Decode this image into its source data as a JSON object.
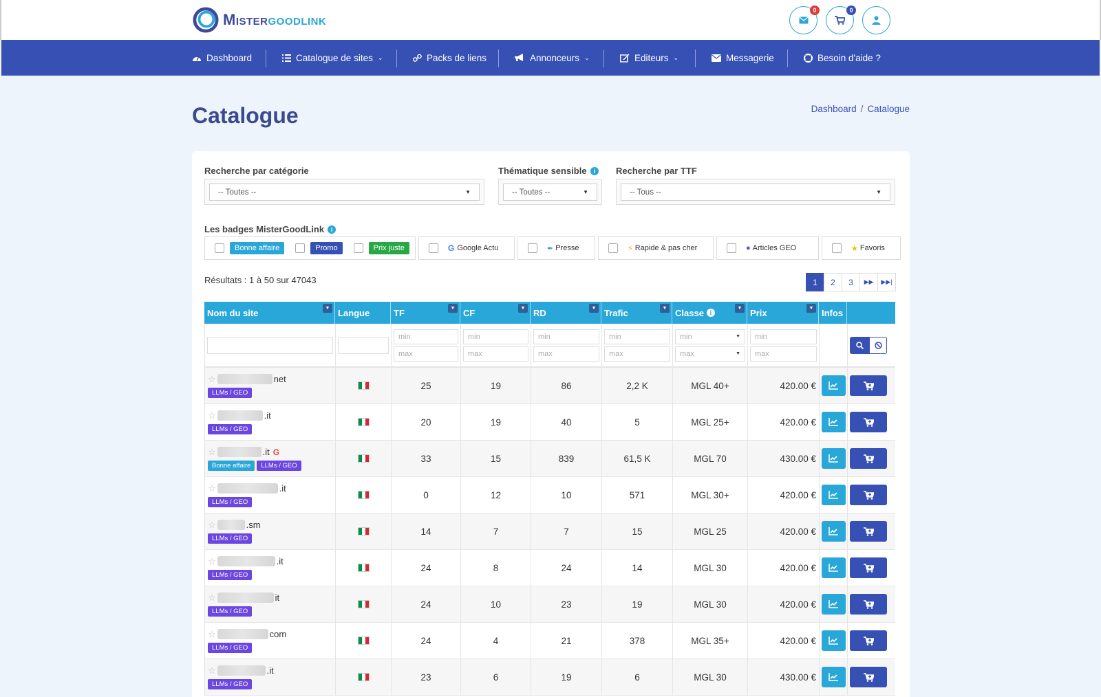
{
  "brand": {
    "name_part1": "Mister",
    "name_part2": "goodlink"
  },
  "header": {
    "messages_count": "0",
    "cart_count": "0"
  },
  "nav": [
    {
      "label": "Dashboard",
      "icon": "dashboard-icon"
    },
    {
      "label": "Catalogue de sites",
      "icon": "list-icon",
      "dropdown": true
    },
    {
      "label": "Packs de liens",
      "icon": "link-icon"
    },
    {
      "label": "Annonceurs",
      "icon": "megaphone-icon",
      "dropdown": true
    },
    {
      "label": "Editeurs",
      "icon": "edit-icon",
      "dropdown": true
    },
    {
      "label": "Messagerie",
      "icon": "envelope-icon"
    },
    {
      "label": "Besoin d'aide ?",
      "icon": "lifering-icon"
    }
  ],
  "page": {
    "title": "Catalogue",
    "breadcrumb": [
      "Dashboard",
      "Catalogue"
    ]
  },
  "filters": {
    "category": {
      "label": "Recherche par catégorie",
      "value": "-- Toutes --"
    },
    "sensitive": {
      "label": "Thématique sensible",
      "value": "-- Toutes --"
    },
    "ttf": {
      "label": "Recherche par TTF",
      "value": "-- Tous --"
    },
    "badges_label": "Les badges MisterGoodLink",
    "badges": {
      "bonne_affaire": "Bonne affaire",
      "promo": "Promo",
      "prix_juste": "Prix juste",
      "google_actu": "Google Actu",
      "presse": "Presse",
      "rapide": "Rapide & pas cher",
      "articles_geo": "Articles GEO",
      "favoris": "Favoris"
    }
  },
  "results": {
    "text": "Résultats : 1 à 50 sur 47043"
  },
  "pagination": {
    "pages": [
      "1",
      "2",
      "3"
    ],
    "active": "1"
  },
  "table": {
    "headers": {
      "site": "Nom du site",
      "langue": "Langue",
      "tf": "TF",
      "cf": "CF",
      "rd": "RD",
      "trafic": "Trafic",
      "classe": "Classe",
      "prix": "Prix",
      "infos": "Infos"
    },
    "min_placeholder": "min",
    "max_placeholder": "max",
    "rows": [
      {
        "suffix": "net",
        "tags": [
          "LLMs / GEO"
        ],
        "tf": "25",
        "cf": "19",
        "rd": "86",
        "trafic": "2,2 K",
        "classe": "MGL 40+",
        "prix": "420.00 €"
      },
      {
        "suffix": ".it",
        "tags": [
          "LLMs / GEO"
        ],
        "tf": "20",
        "cf": "19",
        "rd": "40",
        "trafic": "5",
        "classe": "MGL 25+",
        "prix": "420.00 €"
      },
      {
        "suffix": ".it",
        "google": true,
        "tags": [
          "Bonne affaire",
          "LLMs / GEO"
        ],
        "tf": "33",
        "cf": "15",
        "rd": "839",
        "trafic": "61,5 K",
        "classe": "MGL 70",
        "prix": "430.00 €"
      },
      {
        "suffix": ".it",
        "tags": [
          "LLMs / GEO"
        ],
        "tf": "0",
        "cf": "12",
        "rd": "10",
        "trafic": "571",
        "classe": "MGL 30+",
        "prix": "420.00 €"
      },
      {
        "suffix": ".sm",
        "tags": [
          "LLMs / GEO"
        ],
        "tf": "14",
        "cf": "7",
        "rd": "7",
        "trafic": "15",
        "classe": "MGL 25",
        "prix": "420.00 €"
      },
      {
        "suffix": ".it",
        "tags": [
          "LLMs / GEO"
        ],
        "tf": "24",
        "cf": "8",
        "rd": "24",
        "trafic": "14",
        "classe": "MGL 30",
        "prix": "420.00 €"
      },
      {
        "suffix": "it",
        "tags": [
          "LLMs / GEO"
        ],
        "tf": "24",
        "cf": "10",
        "rd": "23",
        "trafic": "19",
        "classe": "MGL 30",
        "prix": "420.00 €"
      },
      {
        "suffix": "com",
        "tags": [
          "LLMs / GEO"
        ],
        "tf": "24",
        "cf": "4",
        "rd": "21",
        "trafic": "378",
        "classe": "MGL 35+",
        "prix": "420.00 €"
      },
      {
        "suffix": ".it",
        "tags": [
          "LLMs / GEO"
        ],
        "tf": "23",
        "cf": "6",
        "rd": "19",
        "trafic": "6",
        "classe": "MGL 30",
        "prix": "430.00 €"
      }
    ]
  },
  "colors": {
    "primary": "#3650b4",
    "accent": "#2aa7d9",
    "geo_tag": "#6b47e0",
    "deal_tag": "#2aa7d9",
    "promo_tag": "#3650b4",
    "fair_tag": "#28a745"
  }
}
